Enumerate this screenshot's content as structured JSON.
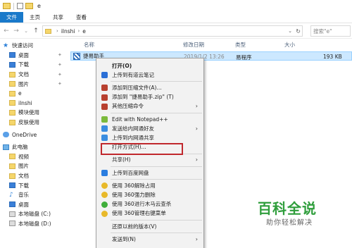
{
  "window": {
    "title": "e"
  },
  "ribbon_tabs": [
    "文件",
    "主页",
    "共享",
    "查看"
  ],
  "address": {
    "crumbs": [
      "ilnshi",
      "e"
    ],
    "search_placeholder": "搜索\"e\""
  },
  "navigation": {
    "quick_access": "快速访问",
    "items": [
      {
        "label": "桌面",
        "icon": "desktop-icon",
        "pinned": true
      },
      {
        "label": "下载",
        "icon": "download-icon",
        "pinned": true
      },
      {
        "label": "文档",
        "icon": "documents-icon",
        "pinned": true
      },
      {
        "label": "图片",
        "icon": "pictures-icon",
        "pinned": true
      },
      {
        "label": "e",
        "icon": "folder-icon",
        "pinned": false
      },
      {
        "label": "ilnshi",
        "icon": "folder-icon",
        "pinned": false
      },
      {
        "label": "模块使用",
        "icon": "folder-icon",
        "pinned": false
      },
      {
        "label": "皮肤使用",
        "icon": "folder-icon",
        "pinned": false
      }
    ],
    "onedrive": "OneDrive",
    "this_pc": "此电脑",
    "pc_items": [
      {
        "label": "视频",
        "icon": "video-icon"
      },
      {
        "label": "图片",
        "icon": "pictures-icon"
      },
      {
        "label": "文档",
        "icon": "documents-icon"
      },
      {
        "label": "下载",
        "icon": "download-icon"
      },
      {
        "label": "音乐",
        "icon": "music-icon"
      },
      {
        "label": "桌面",
        "icon": "desktop-icon"
      },
      {
        "label": "本地磁盘 (C:)",
        "icon": "drive-icon"
      },
      {
        "label": "本地磁盘 (D:)",
        "icon": "drive-icon"
      }
    ]
  },
  "columns": {
    "name": "名称",
    "modified": "修改日期",
    "type": "类型",
    "size": "大小"
  },
  "file": {
    "name": "捷易助手",
    "modified": "2019/1/2 13:26",
    "type": "易程序",
    "size": "193 KB"
  },
  "context_menu": [
    {
      "label": "打开(O)",
      "bold": true,
      "icon": ""
    },
    {
      "label": "上传到有道云笔记",
      "icon": "youdao-icon"
    },
    {
      "sep": true
    },
    {
      "label": "添加到压缩文件(A)...",
      "icon": "archive-icon"
    },
    {
      "label": "添加到 \"捷易助手.zip\" (T)",
      "icon": "archive-icon"
    },
    {
      "label": "其他压缩命令",
      "icon": "archive-icon",
      "submenu": true
    },
    {
      "sep": true
    },
    {
      "label": "Edit with Notepad++",
      "icon": "notepad-icon"
    },
    {
      "label": "发送给内网通好友",
      "icon": "share-icon",
      "submenu": true
    },
    {
      "label": "上传到内网通共享",
      "icon": "share-icon"
    },
    {
      "label": "打开方式(H)...",
      "icon": ""
    },
    {
      "sep": true
    },
    {
      "label": "共享(H)",
      "icon": "",
      "submenu": true
    },
    {
      "sep": true
    },
    {
      "label": "上传到百度网盘",
      "icon": "baidu-icon"
    },
    {
      "sep": true
    },
    {
      "label": "使用 360解除占用",
      "icon": "360-icon"
    },
    {
      "label": "使用 360强力删除",
      "icon": "360-icon"
    },
    {
      "label": "使用 360进行木马云查杀",
      "icon": "360-green-icon"
    },
    {
      "label": "使用 360管理右键菜单",
      "icon": "360-icon"
    },
    {
      "sep": true
    },
    {
      "label": "还原以前的版本(V)",
      "icon": ""
    },
    {
      "sep": true
    },
    {
      "label": "发送到(N)",
      "icon": "",
      "submenu": true
    }
  ],
  "watermark": {
    "title": "百科全说",
    "subtitle": "助你轻松解决"
  },
  "colors": {
    "accent": "#1979ca",
    "selection": "#cce8ff",
    "highlight_box": "#c0282d",
    "watermark": "#2f9e3c"
  }
}
